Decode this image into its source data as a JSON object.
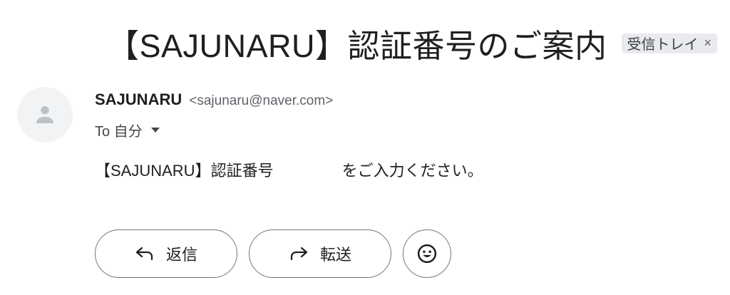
{
  "email": {
    "subject": "【SAJUNARU】認証番号のご案内",
    "label_chip": "受信トレイ",
    "label_chip_close": "×",
    "sender_name": "SAJUNARU",
    "sender_email": "<sajunaru@naver.com>",
    "to_text": "To 自分",
    "body_part1": "【SAJUNARU】認証番号",
    "body_part2": "をご入力ください。"
  },
  "actions": {
    "reply_label": "返信",
    "forward_label": "転送"
  },
  "icons": {
    "avatar": "person-icon",
    "reply": "reply-arrow-icon",
    "forward": "forward-arrow-icon",
    "emoji": "emoji-smile-icon",
    "caret": "caret-down-icon"
  }
}
